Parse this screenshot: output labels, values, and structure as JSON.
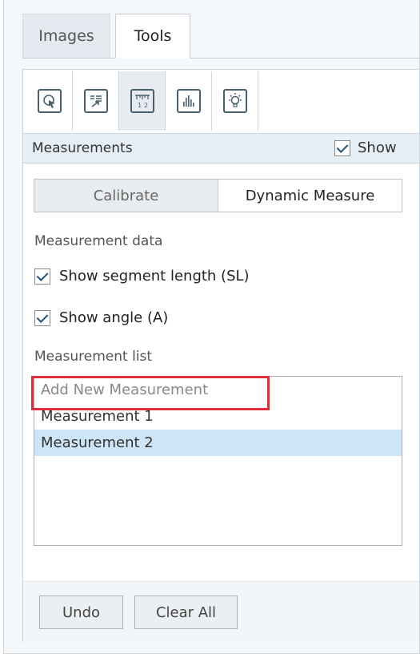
{
  "tabs": [
    {
      "label": "Images",
      "active": false
    },
    {
      "label": "Tools",
      "active": true
    }
  ],
  "toolbar": {
    "buttons": [
      {
        "icon": "pointer-select-icon",
        "selected": false
      },
      {
        "icon": "list-export-icon",
        "selected": false
      },
      {
        "icon": "ruler-measure-icon",
        "selected": true
      },
      {
        "icon": "histogram-icon",
        "selected": false
      },
      {
        "icon": "lightbulb-icon",
        "selected": false
      }
    ]
  },
  "measurements": {
    "title": "Measurements",
    "show_label": "Show",
    "show_checked": true,
    "modes": [
      "Calibrate",
      "Dynamic Measure"
    ],
    "active_mode": "Dynamic Measure",
    "data_heading": "Measurement data",
    "options": [
      {
        "label": "Show segment length (SL)",
        "checked": true
      },
      {
        "label": "Show angle (A)",
        "checked": true
      }
    ],
    "list_heading": "Measurement list",
    "list": {
      "placeholder": "Add New Measurement",
      "items": [
        "Measurement 1",
        "Measurement 2"
      ],
      "selected": "Measurement 2"
    }
  },
  "footer": {
    "undo_label": "Undo",
    "clear_label": "Clear All"
  },
  "colors": {
    "highlight": "#e02e3a",
    "selection": "#cde6f7",
    "section_header": "#e6eef6"
  }
}
